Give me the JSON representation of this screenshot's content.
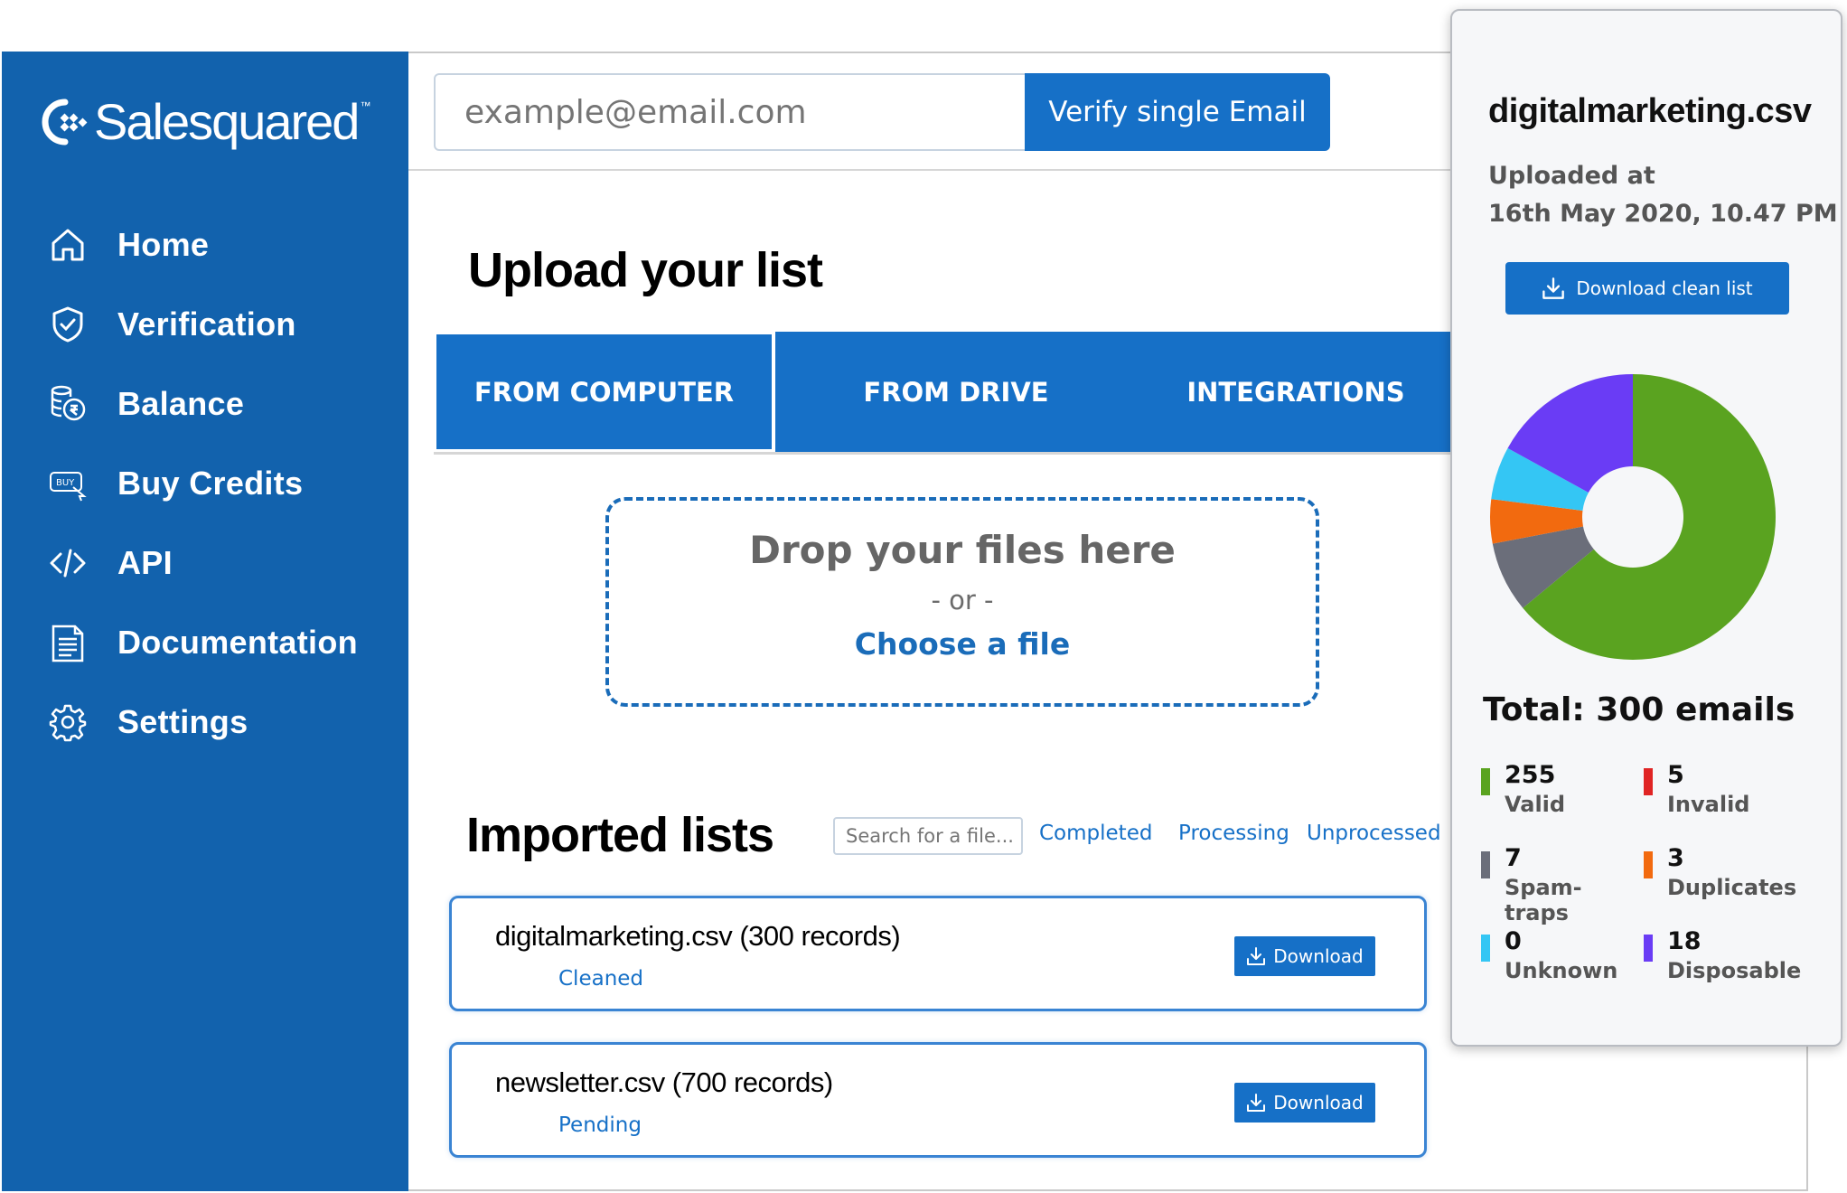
{
  "brand": {
    "name": "Salesquared",
    "tm": "™"
  },
  "sidebar": {
    "items": [
      {
        "label": "Home",
        "icon": "home-icon"
      },
      {
        "label": "Verification",
        "icon": "shield-check-icon"
      },
      {
        "label": "Balance",
        "icon": "coins-icon"
      },
      {
        "label": "Buy Credits",
        "icon": "buy-credits-icon"
      },
      {
        "label": "API",
        "icon": "code-icon"
      },
      {
        "label": "Documentation",
        "icon": "document-icon"
      },
      {
        "label": "Settings",
        "icon": "gear-icon"
      }
    ]
  },
  "topbar": {
    "email_placeholder": "example@email.com",
    "verify_label": "Verify single Email"
  },
  "upload": {
    "title": "Upload your list",
    "tabs": [
      "FROM COMPUTER",
      "FROM DRIVE",
      "INTEGRATIONS"
    ],
    "drop_title": "Drop your files here",
    "drop_or": "- or -",
    "choose_label": "Choose a file"
  },
  "imported": {
    "title": "Imported lists",
    "search_placeholder": "Search for a file...",
    "filters": [
      "Completed",
      "Processing",
      "Unprocessed"
    ],
    "files": [
      {
        "name": "digitalmarketing.csv (300 records)",
        "status": "Cleaned",
        "download_label": "Download"
      },
      {
        "name": "newsletter.csv (700 records)",
        "status": "Pending",
        "download_label": "Download"
      }
    ]
  },
  "panel": {
    "file_name": "digitalmarketing.csv",
    "uploaded_label": "Uploaded at",
    "uploaded_at": "16th May 2020, 10.47 PM",
    "download_clean_label": "Download clean list",
    "total_label": "Total: 300 emails",
    "legend": [
      {
        "value": "255",
        "label": "Valid",
        "color": "#5aa320"
      },
      {
        "value": "5",
        "label": "Invalid",
        "color": "#e02424"
      },
      {
        "value": "7",
        "label": "Spam-traps",
        "color": "#6b6e7a"
      },
      {
        "value": "3",
        "label": "Duplicates",
        "color": "#f26a0f"
      },
      {
        "value": "0",
        "label": "Unknown",
        "color": "#34c6f4"
      },
      {
        "value": "18",
        "label": "Disposable",
        "color": "#6a3cf5"
      }
    ]
  },
  "chart_data": {
    "type": "pie",
    "segments": [
      {
        "label": "Valid",
        "value": 0.64,
        "color": "#5aa320"
      },
      {
        "label": "Spam-traps",
        "value": 0.08,
        "color": "#6b6e7a"
      },
      {
        "label": "Duplicates",
        "value": 0.05,
        "color": "#f26a0f"
      },
      {
        "label": "Unknown",
        "value": 0.06,
        "color": "#34c6f4"
      },
      {
        "label": "Disposable",
        "value": 0.17,
        "color": "#6a3cf5"
      }
    ]
  }
}
